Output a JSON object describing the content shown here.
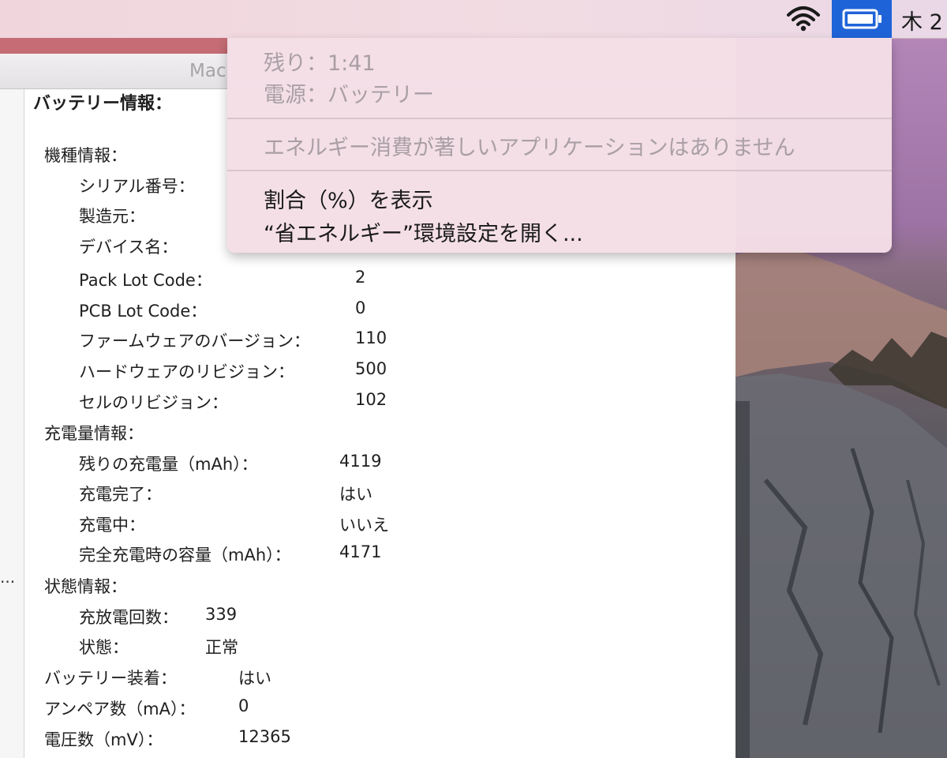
{
  "menubar": {
    "clock_text": "木 2",
    "icons": [
      "wifi-icon",
      "battery-icon"
    ],
    "accent_color": "#1f63d8"
  },
  "battery_menu": {
    "remaining": "残り：1:41",
    "power_source": "電源：バッテリー",
    "no_apps": "エネルギー消費が著しいアプリケーションはありません",
    "show_percentage": "割合（%）を表示",
    "open_prefs": "“省エネルギー”環境設定を開く..."
  },
  "window": {
    "title": "Mac",
    "sidebar_ellipsis": "..."
  },
  "battery_info": {
    "section_title": "バッテリー情報：",
    "model_info": {
      "heading": "機種情報：",
      "serial_label": "シリアル番号：",
      "manufacturer_label": "製造元：",
      "device_name_label": "デバイス名：",
      "pack_lot_label": "Pack Lot Code：",
      "pack_lot_value": "2",
      "pcb_lot_label": "PCB Lot Code：",
      "pcb_lot_value": "0",
      "firmware_label": "ファームウェアのバージョン：",
      "firmware_value": "110",
      "hardware_label": "ハードウェアのリビジョン：",
      "hardware_value": "500",
      "cell_label": "セルのリビジョン：",
      "cell_value": "102"
    },
    "charge_info": {
      "heading": "充電量情報：",
      "remaining_label": "残りの充電量（mAh）：",
      "remaining_value": "4119",
      "fully_charged_label": "充電完了：",
      "fully_charged_value": "はい",
      "charging_label": "充電中：",
      "charging_value": "いいえ",
      "full_capacity_label": "完全充電時の容量（mAh）：",
      "full_capacity_value": "4171"
    },
    "health_info": {
      "heading": "状態情報：",
      "cycle_label": "充放電回数：",
      "cycle_value": "339",
      "condition_label": "状態：",
      "condition_value": "正常"
    },
    "installed_label": "バッテリー装着：",
    "installed_value": "はい",
    "amperage_label": "アンペア数（mA）：",
    "amperage_value": "0",
    "voltage_label": "電圧数（mV）：",
    "voltage_value": "12365"
  }
}
